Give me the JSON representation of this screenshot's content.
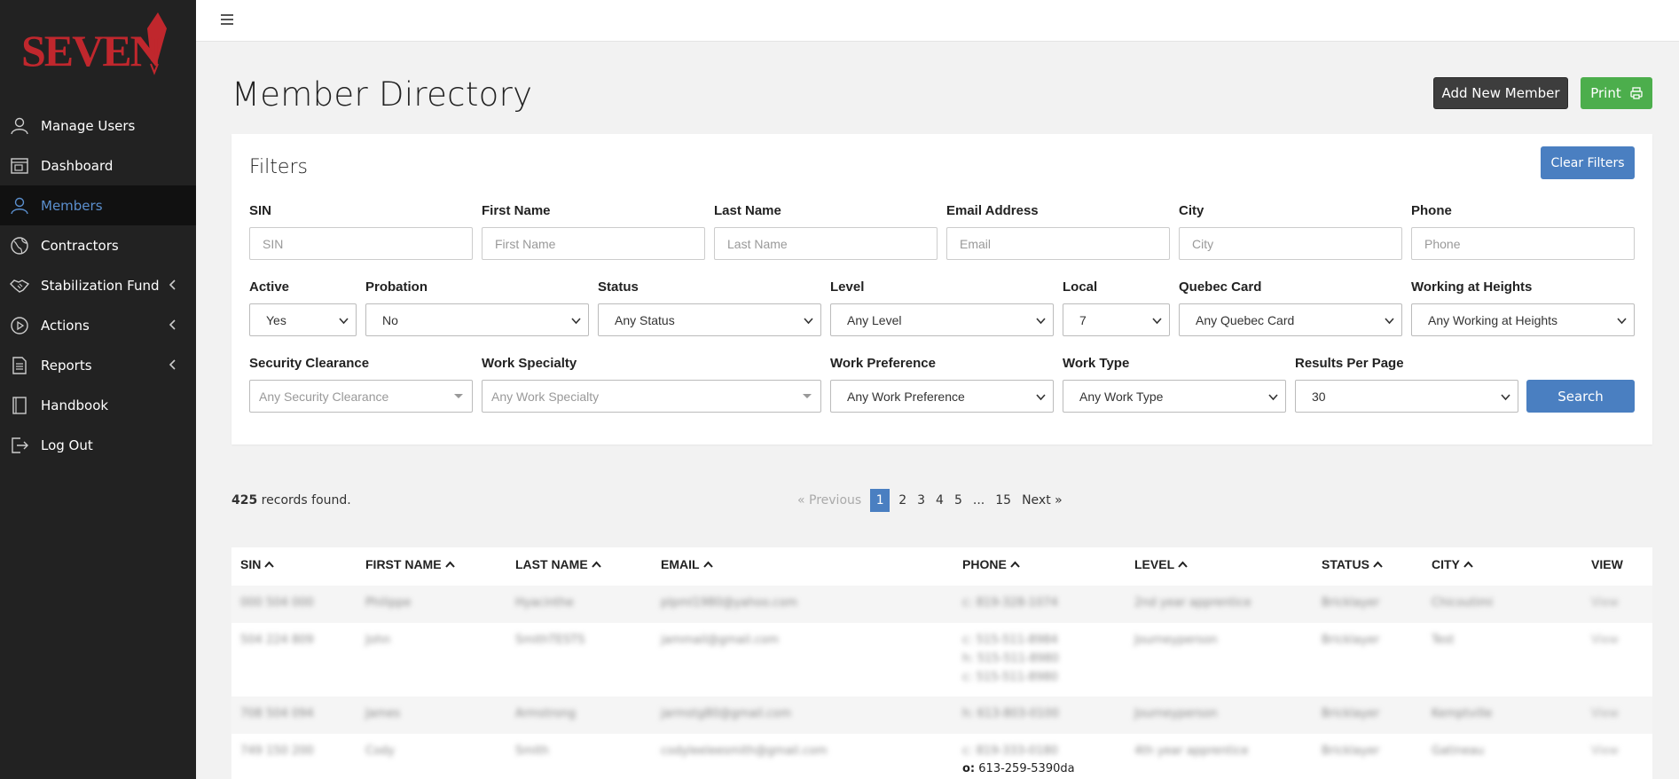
{
  "brand": {
    "logo_text": "SEVEN",
    "accent": "#c0272d"
  },
  "sidebar": {
    "items": [
      {
        "label": "Manage Users",
        "icon": "user-icon",
        "active": false,
        "has_chevron": false
      },
      {
        "label": "Dashboard",
        "icon": "dashboard-icon",
        "active": false,
        "has_chevron": false
      },
      {
        "label": "Members",
        "icon": "user-icon",
        "active": true,
        "has_chevron": false
      },
      {
        "label": "Contractors",
        "icon": "globe-icon",
        "active": false,
        "has_chevron": false
      },
      {
        "label": "Stabilization Fund",
        "icon": "handshake-icon",
        "active": false,
        "has_chevron": true
      },
      {
        "label": "Actions",
        "icon": "play-icon",
        "active": false,
        "has_chevron": true
      },
      {
        "label": "Reports",
        "icon": "document-icon",
        "active": false,
        "has_chevron": true
      },
      {
        "label": "Handbook",
        "icon": "book-icon",
        "active": false,
        "has_chevron": false
      },
      {
        "label": "Log Out",
        "icon": "logout-icon",
        "active": false,
        "has_chevron": false
      }
    ]
  },
  "header": {
    "title": "Member Directory",
    "add_label": "Add New Member",
    "print_label": "Print"
  },
  "filters": {
    "title": "Filters",
    "clear_label": "Clear Filters",
    "search_label": "Search",
    "row1": [
      {
        "label": "SIN",
        "placeholder": "SIN"
      },
      {
        "label": "First Name",
        "placeholder": "First Name"
      },
      {
        "label": "Last Name",
        "placeholder": "Last Name"
      },
      {
        "label": "Email Address",
        "placeholder": "Email"
      },
      {
        "label": "City",
        "placeholder": "City"
      },
      {
        "label": "Phone",
        "placeholder": "Phone"
      }
    ],
    "row2": [
      {
        "label": "Active",
        "value": "Yes"
      },
      {
        "label": "Probation",
        "value": "No"
      },
      {
        "label": "Status",
        "value": "Any Status"
      },
      {
        "label": "Level",
        "value": "Any Level"
      },
      {
        "label": "Local",
        "value": "7"
      },
      {
        "label": "Quebec Card",
        "value": "Any Quebec Card"
      },
      {
        "label": "Working at Heights",
        "value": "Any Working at Heights"
      }
    ],
    "row3": [
      {
        "label": "Security Clearance",
        "value": "Any Security Clearance"
      },
      {
        "label": "Work Specialty",
        "value": "Any Work Specialty"
      },
      {
        "label": "Work Preference",
        "value": "Any Work Preference"
      },
      {
        "label": "Work Type",
        "value": "Any Work Type"
      },
      {
        "label": "Results Per Page",
        "value": "30"
      }
    ]
  },
  "results": {
    "count": "425",
    "suffix": " records found.",
    "pager": {
      "previous": "« Previous",
      "pages": [
        "1",
        "2",
        "3",
        "4",
        "5",
        "...",
        "15"
      ],
      "current": "1",
      "next": "Next »"
    }
  },
  "table": {
    "columns": [
      "SIN",
      "FIRST NAME",
      "LAST NAME",
      "EMAIL",
      "PHONE",
      "LEVEL",
      "STATUS",
      "CITY",
      "VIEW"
    ],
    "rows": [
      {
        "sin": "000 504 000",
        "first": "Philippe",
        "last": "Hyacinthe",
        "email": "plpml1980@yahoo.com",
        "phones": [
          "c: 819-328-1074"
        ],
        "level": "2nd year apprentice",
        "status": "Bricklayer",
        "city": "Chicoutimi",
        "view": "View"
      },
      {
        "sin": "504 224 809",
        "first": "John",
        "last": "SmithTESTS",
        "email": "jammail@gmail.com",
        "phones": [
          "c: 515-511-8984",
          "h: 515-511-8980",
          "c: 515-511-8980"
        ],
        "level": "Journeyperson",
        "status": "Bricklayer",
        "city": "Test",
        "view": "View"
      },
      {
        "sin": "708 504 094",
        "first": "James",
        "last": "Armstrong",
        "email": "jarmstg80@gmail.com",
        "phones": [
          "h: 613-803-0100"
        ],
        "level": "Journeyperson",
        "status": "Bricklayer",
        "city": "Kemptville",
        "view": "View"
      },
      {
        "sin": "749 150 200",
        "first": "Cody",
        "last": "Smith",
        "email": "codyleeleesmith@gmail.com",
        "phones": [
          "c: 819-333-0180"
        ],
        "level": "4th year apprentice",
        "status": "Bricklayer",
        "city": "Gatineau",
        "view": "View"
      }
    ],
    "clear_phone_prefix": "o:",
    "clear_phone_value": " 613-259-5390da"
  }
}
